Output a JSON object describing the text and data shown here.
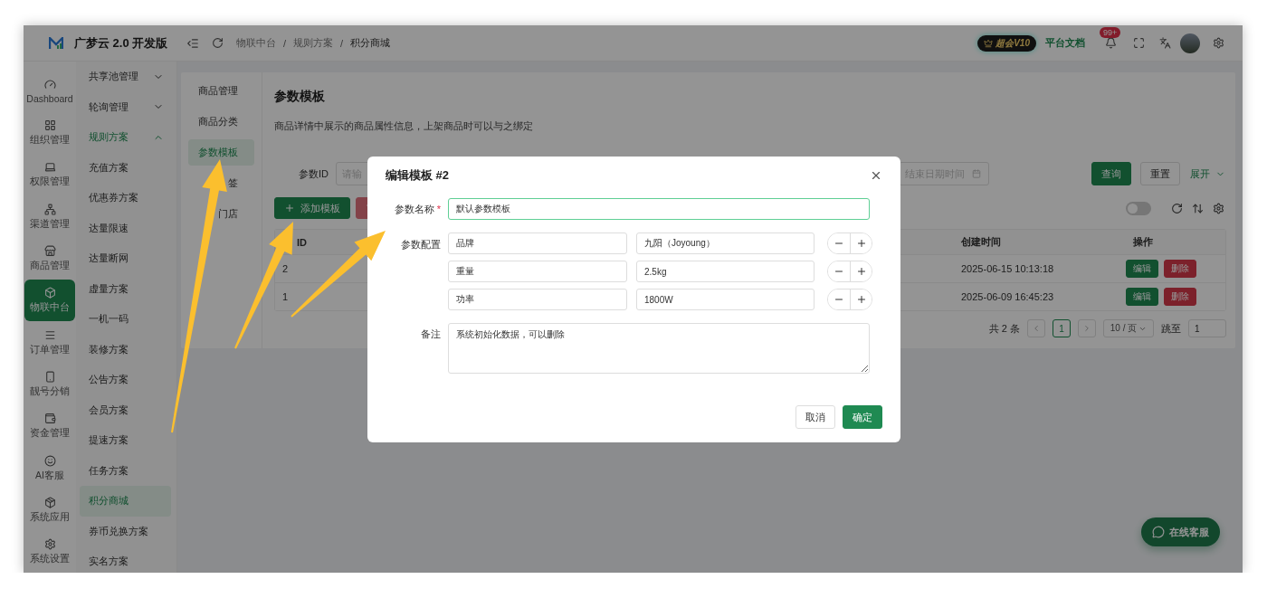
{
  "app": {
    "name": "广梦云 2.0 开发版"
  },
  "header": {
    "breadcrumb": [
      "物联中台",
      "规则方案",
      "积分商城"
    ],
    "breadcrumb_separator": "/",
    "vip_badge": "超会V10",
    "docs_link": "平台文档",
    "notification_count": "99+"
  },
  "rail": [
    {
      "label": "Dashboard",
      "selected": false
    },
    {
      "label": "组织管理",
      "selected": false
    },
    {
      "label": "权限管理",
      "selected": false
    },
    {
      "label": "渠道管理",
      "selected": false
    },
    {
      "label": "商品管理",
      "selected": false
    },
    {
      "label": "物联中台",
      "selected": true
    },
    {
      "label": "订单管理",
      "selected": false
    },
    {
      "label": "靓号分销",
      "selected": false
    },
    {
      "label": "资金管理",
      "selected": false
    },
    {
      "label": "AI客服",
      "selected": false
    },
    {
      "label": "系统应用",
      "selected": false
    },
    {
      "label": "系统设置",
      "selected": false
    }
  ],
  "menu": [
    {
      "label": "共享池管理",
      "expanded": false
    },
    {
      "label": "轮询管理",
      "expanded": false
    },
    {
      "label": "规则方案",
      "expanded": true,
      "children": [
        {
          "label": "充值方案",
          "selected": false
        },
        {
          "label": "优惠券方案",
          "selected": false
        },
        {
          "label": "达量限速",
          "selected": false
        },
        {
          "label": "达量断网",
          "selected": false
        },
        {
          "label": "虚量方案",
          "selected": false
        },
        {
          "label": "一机一码",
          "selected": false
        },
        {
          "label": "装修方案",
          "selected": false
        },
        {
          "label": "公告方案",
          "selected": false
        },
        {
          "label": "会员方案",
          "selected": false
        },
        {
          "label": "提速方案",
          "selected": false
        },
        {
          "label": "任务方案",
          "selected": false
        },
        {
          "label": "积分商城",
          "selected": true
        },
        {
          "label": "券币兑换方案",
          "selected": false
        },
        {
          "label": "实名方案",
          "selected": false
        }
      ]
    }
  ],
  "tabs": [
    {
      "label": "商品管理",
      "selected": false
    },
    {
      "label": "商品分类",
      "selected": false
    },
    {
      "label": "参数模板",
      "selected": true
    },
    {
      "label": "签",
      "selected": false
    },
    {
      "label": "门店",
      "selected": false
    }
  ],
  "page": {
    "title": "参数模板",
    "description": "商品详情中展示的商品属性信息，上架商品时可以与之绑定"
  },
  "filters": {
    "id_label": "参数ID",
    "id_placeholder": "请输",
    "end_date_placeholder": "结束日期时间",
    "search": "查询",
    "reset": "重置",
    "expand": "展开"
  },
  "toolbar": {
    "add": "添加模板",
    "switch_on": false
  },
  "table": {
    "columns": [
      "ID",
      "创建时间",
      "操作"
    ],
    "rows": [
      {
        "id": "2",
        "created": "2025-06-15 10:13:18",
        "actions": [
          "编辑",
          "删除"
        ]
      },
      {
        "id": "1",
        "created": "2025-06-09 16:45:23",
        "actions": [
          "编辑",
          "删除"
        ]
      }
    ]
  },
  "pagination": {
    "total": "共 2 条",
    "page": "1",
    "page_size": "10 / 页",
    "jump_label": "跳至",
    "jump_value": "1"
  },
  "dialog": {
    "title": "编辑模板 #2",
    "name_label": "参数名称",
    "name_required_mark": "*",
    "name_value": "默认参数模板",
    "params_label": "参数配置",
    "params": [
      {
        "key": "品牌",
        "value": "九阳（Joyoung）"
      },
      {
        "key": "重量",
        "value": "2.5kg"
      },
      {
        "key": "功率",
        "value": "1800W"
      }
    ],
    "note_label": "备注",
    "note_value": "系统初始化数据，可以删除",
    "cancel": "取消",
    "confirm": "确定"
  },
  "chat_button": "在线客服"
}
